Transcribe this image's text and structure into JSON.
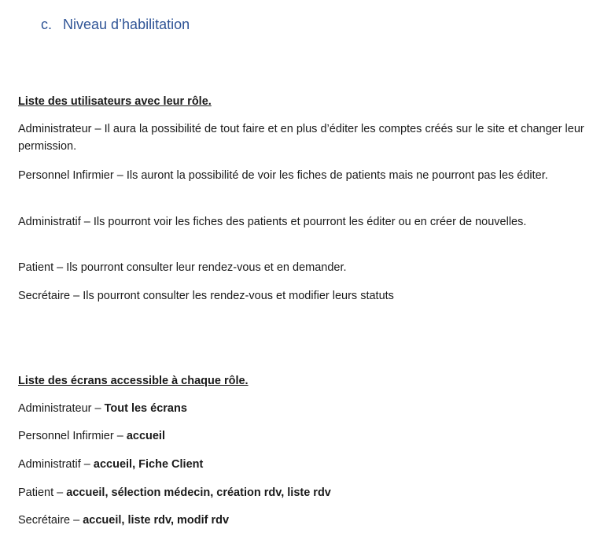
{
  "heading": {
    "number": "c.",
    "title": "Niveau d’habilitation"
  },
  "users_section": {
    "title": "Liste des utilisateurs avec leur rôle.",
    "items": [
      {
        "role": "Administrateur",
        "description": "Il aura la possibilité de tout faire et en plus d’éditer les comptes créés sur le site et changer leur permission."
      },
      {
        "role": "Personnel Infirmier",
        "description": "Ils auront la possibilité de voir les fiches de patients mais ne pourront pas les éditer."
      },
      {
        "role": "Administratif",
        "description": "Ils pourront voir les fiches des patients et pourront les éditer ou en créer de nouvelles."
      },
      {
        "role": "Patient",
        "description": "Ils pourront consulter leur rendez-vous et en demander."
      },
      {
        "role": "Secrétaire",
        "description": "Ils pourront consulter les rendez-vous et modifier leurs statuts"
      }
    ]
  },
  "screens_section": {
    "title": "Liste des écrans accessible à chaque rôle.",
    "items": [
      {
        "role": "Administrateur",
        "screens": "Tout les écrans"
      },
      {
        "role": "Personnel Infirmier",
        "screens": "accueil"
      },
      {
        "role": "Administratif",
        "screens": "accueil, Fiche Client"
      },
      {
        "role": "Patient",
        "screens": "accueil, sélection médecin, création rdv, liste rdv"
      },
      {
        "role": "Secrétaire",
        "screens": "accueil, liste rdv, modif rdv"
      }
    ]
  },
  "separator": " – ",
  "colors": {
    "heading": "#2f5496",
    "text": "#1a1a1a"
  }
}
